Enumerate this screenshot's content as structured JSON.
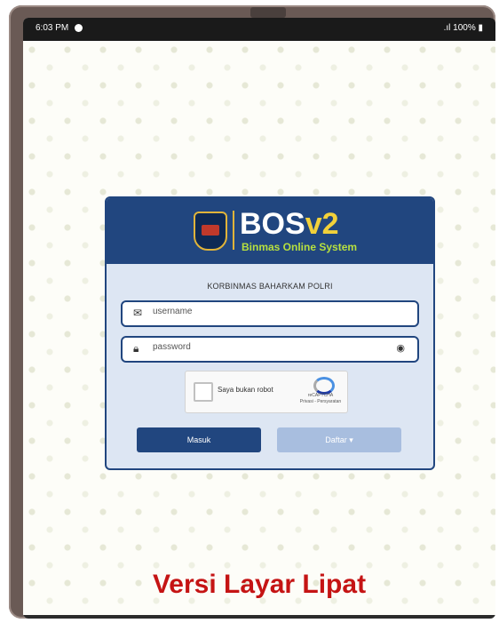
{
  "status_bar": {
    "time": "6:03 PM",
    "battery": ".ıl 100% ▮"
  },
  "app": {
    "logo_title": "BOS",
    "logo_version": "v2",
    "logo_subtitle": "Binmas Online System",
    "organization": "KORBINMAS BAHARKAM POLRI"
  },
  "form": {
    "username_placeholder": "username",
    "password_placeholder": "password",
    "captcha_label": "Saya bukan robot",
    "captcha_brand": "reCAPTCHA",
    "captcha_links": "Privasi - Persyaratan",
    "login_label": "Masuk",
    "register_label": "Daftar ▾"
  },
  "promo_text": "Versi Layar Lipat",
  "colors": {
    "brand": "#21467f",
    "accent_yellow": "#f2d13a",
    "accent_green": "#b7e03f",
    "promo_red": "#c51414"
  },
  "icons": {
    "username": "mail-icon",
    "password": "lock-icon",
    "toggle": "eye-icon"
  }
}
